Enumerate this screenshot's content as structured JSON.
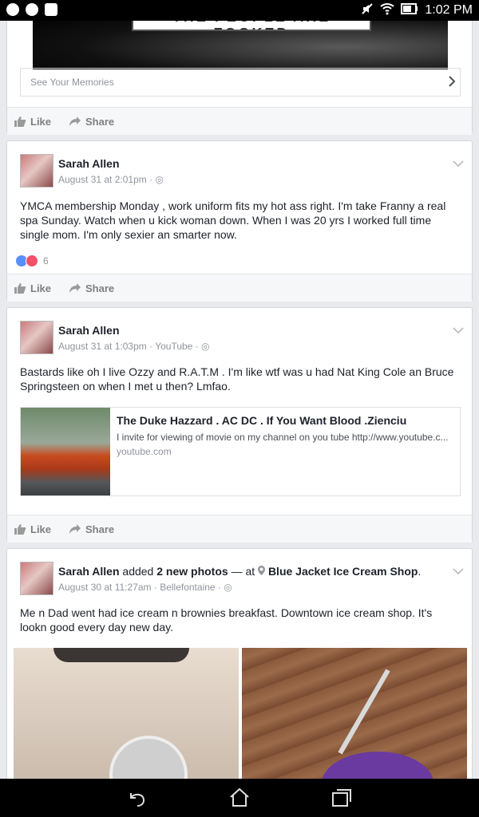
{
  "status": {
    "time": "1:02 PM"
  },
  "memories_card": {
    "image_text": "THE PEOPLE ARE FOOKED",
    "link_label": "See Your Memories",
    "like": "Like",
    "share": "Share"
  },
  "posts": [
    {
      "name": "Sarah Allen",
      "meta": "August 31 at 2:01pm ·",
      "text": "YMCA membership Monday , work uniform fits my hot ass right. I'm take Franny a real spa Sunday. Watch when u kick woman down. When I was 20 yrs I worked full time single mom. I'm only sexier an smarter now.",
      "reactions_count": "6",
      "like": "Like",
      "share": "Share"
    },
    {
      "name": "Sarah Allen",
      "meta": "August 31 at 1:03pm · YouTube ·",
      "text": "Bastards like oh I live Ozzy and R.A.T.M . I'm like wtf was u had Nat King Cole an Bruce Springsteen on when I met u then? Lmfao.",
      "link": {
        "title": "The Duke Hazzard . AC DC . If You Want Blood .Zienciu",
        "description": "I invite for viewing of movie on my channel on you tube http://www.youtube.c...",
        "domain": "youtube.com"
      },
      "like": "Like",
      "share": "Share"
    },
    {
      "name": "Sarah Allen",
      "added": "added",
      "photos": "2 new photos",
      "at": "— at",
      "place": "Blue Jacket Ice Cream Shop",
      "meta": "August 30 at 11:27am · Bellefontaine ·",
      "text": "Me n Dad went had ice cream n brownies breakfast. Downtown ice cream shop. It's lookn good every day new day."
    }
  ]
}
